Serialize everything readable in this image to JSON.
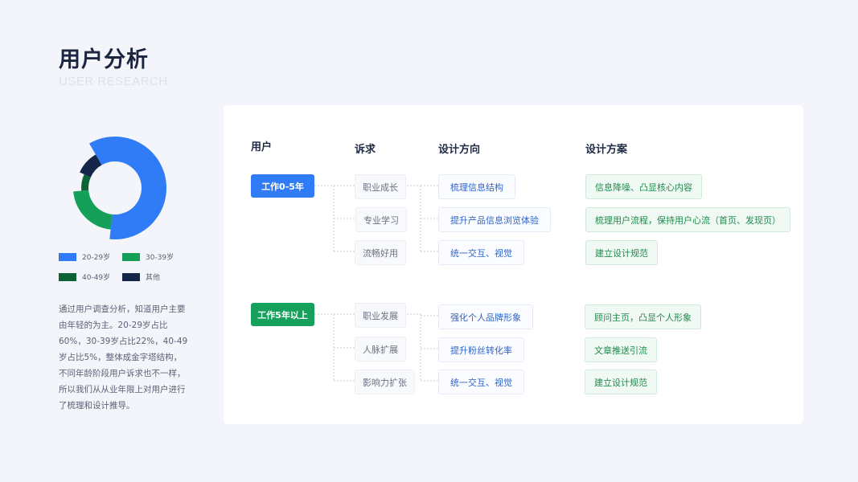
{
  "header": {
    "title": "用户分析",
    "subtitle": "USER RESEARCH"
  },
  "chart_data": {
    "type": "pie",
    "categories": [
      "20-29岁",
      "30-39岁",
      "40-49岁",
      "其他"
    ],
    "values": [
      60,
      22,
      8,
      10
    ],
    "colors": [
      "#2f7cf6",
      "#15a05a",
      "#0c6436",
      "#15264a"
    ]
  },
  "legend": [
    {
      "label": "20-29岁",
      "color": "#2f7cf6"
    },
    {
      "label": "30-39岁",
      "color": "#15a05a"
    },
    {
      "label": "40-49岁",
      "color": "#0c6436"
    },
    {
      "label": "其他",
      "color": "#15264a"
    }
  ],
  "description": "通过用户调查分析，知道用户主要由年轻的为主。20-29岁占比60%，30-39岁占比22%，40-49岁占比5%，整体成金字塔结构，不同年龄阶段用户诉求也不一样，所以我们从从业年限上对用户进行了梳理和设计推导。",
  "columns": {
    "user": "用户",
    "need": "诉求",
    "direction": "设计方向",
    "plan": "设计方案"
  },
  "groups": [
    {
      "user": "工作0-5年",
      "color": "#2f7cf6",
      "needs": [
        "职业成长",
        "专业学习",
        "流畅好用"
      ],
      "directions": [
        "梳理信息结构",
        "提升产品信息浏览体验",
        "统一交互、视觉"
      ],
      "plans": [
        "信息降噪、凸显核心内容",
        "梳理用户流程，保持用户心流（首页、发现页）",
        "建立设计规范"
      ]
    },
    {
      "user": "工作5年以上",
      "color": "#16a05c",
      "needs": [
        "职业发展",
        "人脉扩展",
        "影响力扩张"
      ],
      "directions": [
        "强化个人品牌形象",
        "提升粉丝转化率",
        "统一交互、视觉"
      ],
      "plans": [
        "顾问主页，凸显个人形象",
        "文章推送引流",
        "建立设计规范"
      ]
    }
  ]
}
